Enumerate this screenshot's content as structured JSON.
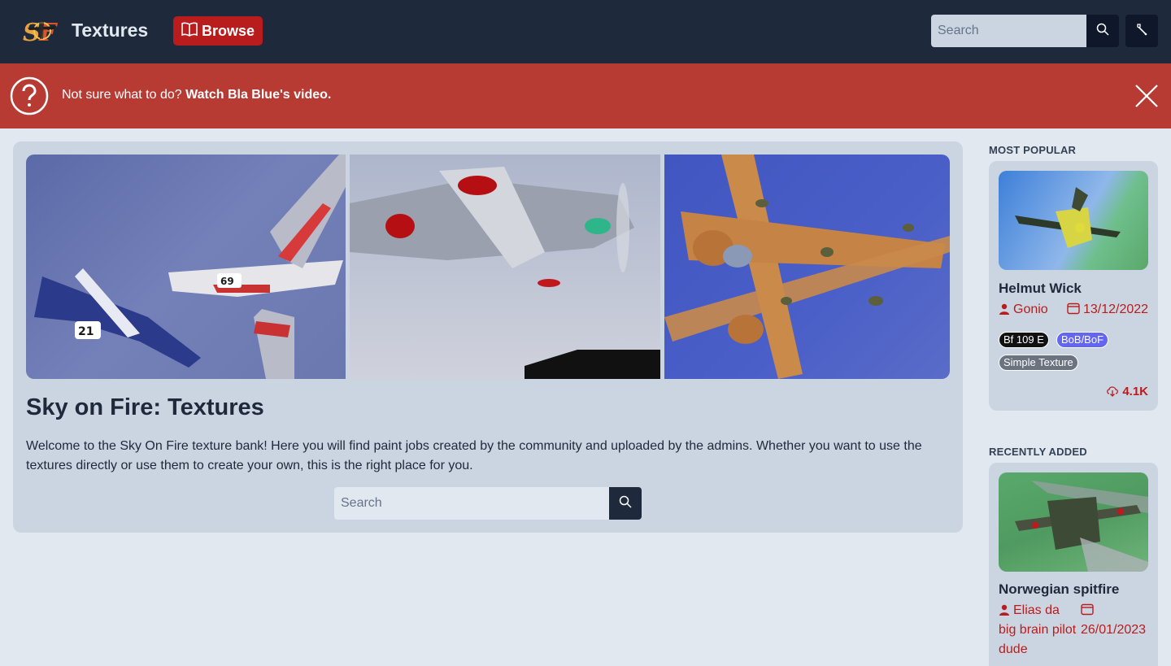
{
  "navbar": {
    "brand": "Textures",
    "browse_label": "Browse",
    "search_placeholder": "Search"
  },
  "banner": {
    "text": "Not sure what to do?",
    "link": "Watch Bla Blue's video."
  },
  "hero": {
    "title": "Sky on Fire: Textures",
    "description": "Welcome to the Sky On Fire texture bank! Here you will find paint jobs created by the community and uploaded by the admins. Whether you want to use the textures directly or use them to create your own, this is the right place for you.",
    "search_placeholder": "Search"
  },
  "sidebar": {
    "popular_heading": "MOST POPULAR",
    "popular": {
      "title": "Helmut Wick",
      "author": "Gonio",
      "date": "13/12/2022",
      "tags": [
        "Bf 109 E",
        "BoB/BoF",
        "Simple Texture"
      ],
      "downloads": "4.1K"
    },
    "recent_heading": "RECENTLY ADDED",
    "recent": {
      "title": "Norwegian spitfire",
      "author_line1": "Elias da",
      "author_line2": "big brain pilot",
      "author_line3": "dude",
      "date": "26/01/2023"
    }
  },
  "colors": {
    "navbar": "#1e293b",
    "accent": "#b91c1c",
    "banner": "#b83b33",
    "background": "#e2e8f0",
    "card": "#cbd5e1"
  }
}
